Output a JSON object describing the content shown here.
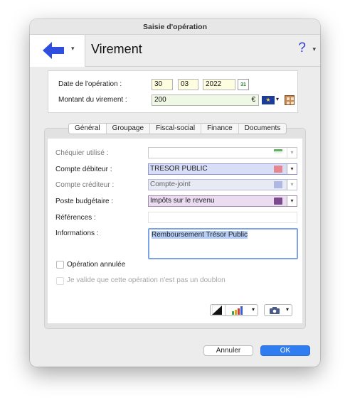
{
  "window": {
    "title": "Saisie d'opération"
  },
  "header": {
    "title": "Virement",
    "help_label": "?"
  },
  "operation": {
    "date_label": "Date de l'opération :",
    "day": "30",
    "month": "03",
    "year": "2022",
    "calendar_day": "31",
    "amount_label": "Montant du virement :",
    "amount": "200",
    "currency_symbol": "€"
  },
  "tabs": [
    {
      "label": "Général",
      "active": true
    },
    {
      "label": "Groupage",
      "active": false
    },
    {
      "label": "Fiscal-social",
      "active": false
    },
    {
      "label": "Finance",
      "active": false
    },
    {
      "label": "Documents",
      "active": false
    }
  ],
  "form": {
    "chequier_label": "Chéquier utilisé :",
    "chequier_value": "",
    "debit_label": "Compte débiteur :",
    "debit_value": "TRESOR PUBLIC",
    "credit_label": "Compte créditeur :",
    "credit_value": "Compte-joint",
    "budget_label": "Poste budgétaire :",
    "budget_value": "Impôts sur le revenu",
    "references_label": "Références :",
    "references_value": "",
    "info_label": "Informations :",
    "info_value": "Remboursement Trésor Public",
    "annulee_label": "Opération annulée",
    "doublon_label": "Je valide que cette opération n'est pas un doublon"
  },
  "buttons": {
    "cancel": "Annuler",
    "ok": "OK"
  },
  "colors": {
    "accent": "#2f7df1",
    "arrow": "#2f4ee0",
    "debit_bg": "#d9def7",
    "budget_bg": "#ecdcf2",
    "date_bg": "#fffde0"
  }
}
